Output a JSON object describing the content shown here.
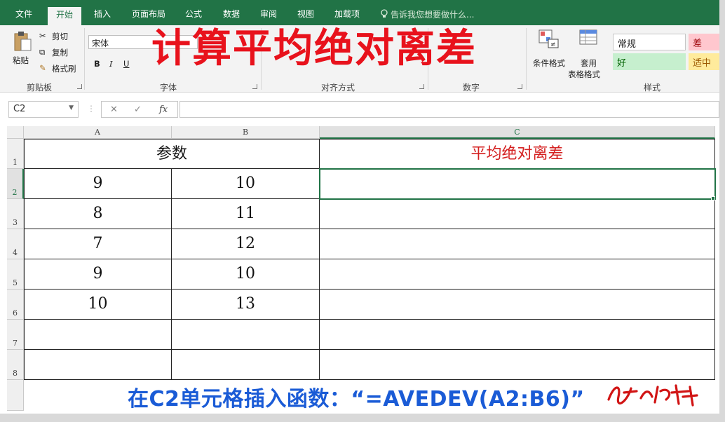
{
  "tabs": [
    "文件",
    "开始",
    "插入",
    "页面布局",
    "公式",
    "数据",
    "审阅",
    "视图",
    "加载项"
  ],
  "tell_me": "告诉我您想要做什么...",
  "ribbon": {
    "clipboard": {
      "paste": "粘贴",
      "cut": "剪切",
      "copy": "复制",
      "format_painter": "格式刷",
      "label": "剪贴板"
    },
    "font": {
      "name": "宋体",
      "bold": "B",
      "italic": "I",
      "underline": "U",
      "label": "字体"
    },
    "alignment": {
      "label": "对齐方式"
    },
    "number": {
      "label": "数字"
    },
    "styles": {
      "conditional": "条件格式",
      "table_format_1": "套用",
      "table_format_2": "表格格式",
      "normal": "常规",
      "bad": "差",
      "good": "好",
      "neutral": "适中",
      "label": "样式"
    }
  },
  "overlay_title": "计算平均绝对离差",
  "formula_bar": {
    "name_box": "C2",
    "cancel": "✕",
    "enter": "✓",
    "fx": "fx",
    "value": ""
  },
  "columns": [
    "A",
    "B",
    "C"
  ],
  "rows": [
    "1",
    "2",
    "3",
    "4",
    "5",
    "6",
    "7",
    "8"
  ],
  "sheet": {
    "header_params": "参数",
    "header_result": "平均绝对离差",
    "col_a": [
      "9",
      "8",
      "7",
      "9",
      "10"
    ],
    "col_b": [
      "10",
      "11",
      "12",
      "10",
      "13"
    ]
  },
  "banner": "在C2单元格插入函数：“=AVEDEV(A2:B6)”",
  "colors": {
    "excel_green": "#217346",
    "title_red": "#e8121c",
    "banner_blue": "#1a5bd6",
    "result_header_red": "#d42020"
  }
}
